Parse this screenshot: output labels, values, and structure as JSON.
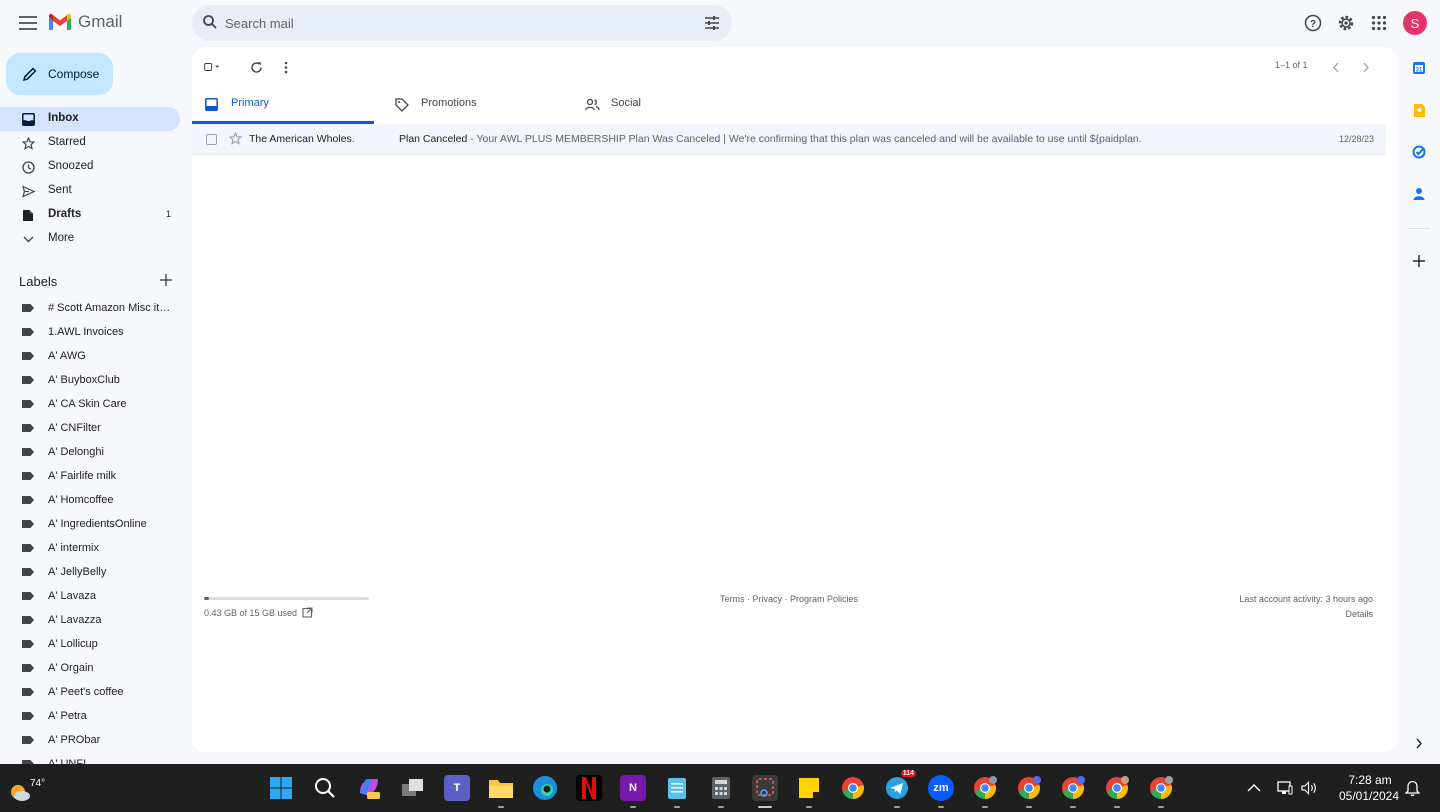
{
  "app": {
    "logo_text": "Gmail"
  },
  "search": {
    "placeholder": "Search mail"
  },
  "account": {
    "avatar_letter": "S",
    "avatar_color": "#e8336a"
  },
  "compose": {
    "label": "Compose"
  },
  "nav": {
    "items": [
      {
        "label": "Inbox",
        "icon": "inbox-icon",
        "count": "",
        "active": true
      },
      {
        "label": "Starred",
        "icon": "star-icon",
        "count": "",
        "active": false
      },
      {
        "label": "Snoozed",
        "icon": "clock-icon",
        "count": "",
        "active": false
      },
      {
        "label": "Sent",
        "icon": "send-icon",
        "count": "",
        "active": false
      },
      {
        "label": "Drafts",
        "icon": "draft-icon",
        "count": "1",
        "active": false
      },
      {
        "label": "More",
        "icon": "chevron-down-icon",
        "count": "",
        "active": false
      }
    ]
  },
  "labels": {
    "title": "Labels",
    "items": [
      "# Scott Amazon Misc ite...",
      "1.AWL Invoices",
      "A' AWG",
      "A' BuyboxClub",
      "A' CA Skin Care",
      "A' CNFilter",
      "A' Delonghi",
      "A' Fairlife milk",
      "A' Homcoffee",
      "A' IngredientsOnline",
      "A' intermix",
      "A' JellyBelly",
      "A' Lavaza",
      "A' Lavazza",
      "A' Lollicup",
      "A' Orgain",
      "A' Peet's coffee",
      "A' Petra",
      "A' PRObar",
      "A' UNFI"
    ]
  },
  "toolbar": {
    "pager": "1–1 of 1"
  },
  "tabs": [
    {
      "label": "Primary",
      "icon": "inbox-icon",
      "active": true
    },
    {
      "label": "Promotions",
      "icon": "tag-icon",
      "active": false
    },
    {
      "label": "Social",
      "icon": "people-icon",
      "active": false
    }
  ],
  "emails": [
    {
      "sender": "The American Wholes.",
      "subject": "Plan Canceled",
      "snippet": " - Your AWL PLUS MEMBERSHIP Plan Was Canceled | We're confirming that this plan was canceled and will be available to use until ${paidplan.",
      "date": "12/28/23"
    }
  ],
  "footer": {
    "storage_text": "0.43 GB of 15 GB used",
    "storage_fraction": 0.029,
    "links": "Terms · Privacy · Program Policies",
    "last_activity": "Last account activity: 3 hours ago",
    "details": "Details"
  },
  "taskbar": {
    "temperature": "74°",
    "time": "7:28 am",
    "date": "05/01/2024",
    "telegram_badge": "114",
    "zoom_label": "zm",
    "teams_label": "T",
    "onenote_label": "N"
  }
}
